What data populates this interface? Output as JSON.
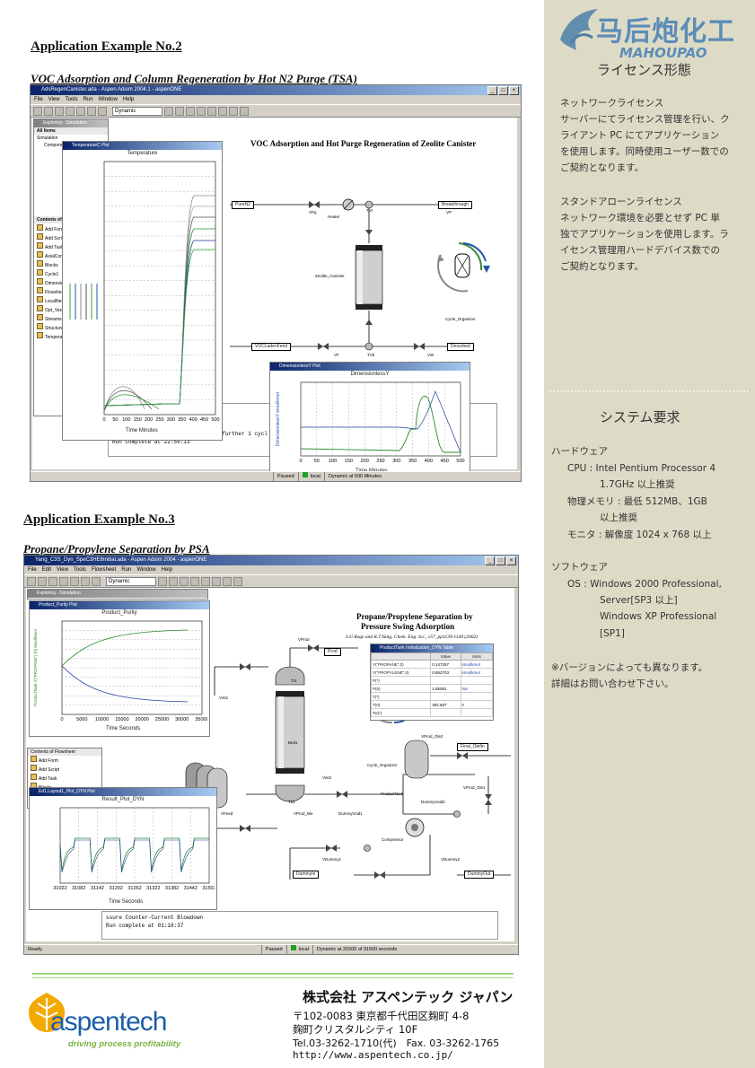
{
  "example2": {
    "heading": "Application Example No.2",
    "subheading": "VOC Adsorption and Column Regeneration by Hot N2 Purge (TSA)",
    "window_title": "AdsRegenCanister.ada - Aspen Adsim 2004.1 - aspenONE",
    "menu": [
      "File",
      "View",
      "Tools",
      "Run",
      "Window",
      "Help"
    ],
    "run_mode": "Dynamic",
    "explorer_title": "Exploring - Simulation",
    "explorer_header": "All Items",
    "explorer_items": [
      "Simulation",
      "Component Lists"
    ],
    "contents_header": "Contents of",
    "contents_items": [
      "Add Form",
      "Add Script",
      "Add Task",
      "AxialCom",
      "Blocks",
      "Cycle1",
      "Dimension",
      "Flowsheet",
      "Localfiles",
      "Opt_Vars",
      "Streams",
      "Structure",
      "Temperat"
    ],
    "flowsheet_title": "VOC Adsorption and Hot Purge Regeneration of Zeolite Canister",
    "tags": {
      "pure_n2": "PureN2",
      "breakthrough": "Breakthrough",
      "voc_feed": "VOCLadenFeed",
      "desorbed": "Desorbed"
    },
    "labels": {
      "vpg": "VPg",
      "heater": "Heater",
      "tvt": "TVt",
      "vp": "VP",
      "canister": "Zeolite_Canister",
      "cycle": "Cycle_Organizer",
      "vf": "VF",
      "tvb": "TVb",
      "vw": "VW"
    },
    "temp_plot": {
      "window": "TemperatureC Plot",
      "title": "Temperature",
      "xlabel": "Time Minutes",
      "xticks": [
        "0",
        "50",
        "100",
        "150",
        "200",
        "250",
        "300",
        "350",
        "400",
        "450",
        "500"
      ]
    },
    "dim_plot": {
      "window": "DimensionlessY Plot",
      "title": "DimensionlessY",
      "ylabel": "DimensionlessY kmol/kmol",
      "xlabel": "Time Minutes",
      "xticks": [
        "0",
        "50",
        "100",
        "150",
        "200",
        "250",
        "300",
        "350",
        "400",
        "450",
        "500"
      ]
    },
    "console": [
      "xp times...",
      "ecuted",
      "atically paused",
      "Press the run button to execute a further 1 cycl",
      "",
      "Run complete at 22:59:13"
    ],
    "status": {
      "state": "Paused",
      "mode": "local",
      "time": "Dynamic at 500 Minutes"
    }
  },
  "example3": {
    "heading": "Application Example No.3",
    "subheading": "Propane/Propylene Separation by PSA",
    "window_title": "Yang_C3S_Dyn_SpeC3HE6Initial.ada - Aspen Adsim 2004 - aspenONE",
    "menu": [
      "File",
      "Edit",
      "View",
      "Tools",
      "Flowsheet",
      "Run",
      "Window",
      "Help"
    ],
    "run_mode": "Dynamic",
    "explorer_title": "Exploring - Simulation",
    "flowsheet_title_1": "Propane/Propylene Separation by",
    "flowsheet_title_2": "Pressure Swing Adsorption",
    "flowsheet_ref": "S.U.Rege and R.T.Yang, Chem. Eng. Sci., v57, pp1139-1149 (2002)",
    "purity_plot": {
      "window": "Product_Purity Plot",
      "title": "Product_Purity",
      "ylabel": "ProductTank.Y(\"PROPANE\") (0) kmol/kmol",
      "xlabel": "Time Seconds",
      "xticks": [
        "0",
        "5000",
        "10000",
        "15000",
        "20000",
        "25000",
        "30000",
        "35000"
      ]
    },
    "result_plot": {
      "window": "Ed1.Layout1_Plot_DYN Plot",
      "title": "Result_Plot_DYN",
      "xlabel": "Time Seconds",
      "xticks": [
        "31022",
        "31082",
        "31142",
        "31202",
        "31262",
        "31322",
        "31382",
        "31442",
        "31502"
      ]
    },
    "table": {
      "window": "ProductTank Initialization_DYN Table",
      "headers": [
        "",
        "Value",
        "Units"
      ],
      "rows": [
        [
          "Y(\"PROPANE\",0)",
          "0.147297",
          "kmol/kmol"
        ],
        [
          "Y(\"PROPYLENE\",0)",
          "0.852703",
          "kmol/kmol"
        ],
        [
          "P(*)",
          "",
          ""
        ],
        [
          "P(0)",
          "1.85081",
          "bar"
        ],
        [
          "T(*)",
          "",
          ""
        ],
        [
          "T(0)",
          "382.687",
          "K"
        ],
        [
          "Tw(*)",
          "",
          ""
        ]
      ]
    },
    "contents_header": "Contents of Flowsheet",
    "contents_items": [
      "Add Form",
      "Add Script",
      "Add Task",
      "Blocks",
      "CS_Control_Table"
    ],
    "tags": {
      "prod": "Prod",
      "final_olefin": "Final_Olefin",
      "dummy_in": "DummyIn",
      "dummy_out": "DummyOut"
    },
    "labels": {
      "vprod": "VProd",
      "tr1": "Tr1",
      "vint1": "Vint1",
      "bed1": "Bed1",
      "cycle": "Cycle_Organizer",
      "intank": "Intank1",
      "tb1": "Tb1",
      "vint2": "Vint2",
      "vprod_ole2": "VProd_Ole2",
      "product_tank": "ProductTank",
      "vprod_ole1": "VProd_Ole1",
      "vfeed": "VFeed",
      "vprod_ble": "VProd_Ble",
      "dummy_void1": "DummyVoid1",
      "dummy_void2": "DummyVoid2",
      "compressor": "Compressor",
      "vdummy1": "VDummy1",
      "vdummy2": "VDummy2"
    },
    "console": [
      "ssure Counter-Current Blowdown",
      "Run complete at 01:18:37"
    ],
    "status": {
      "ready": "Ready",
      "state": "Paused",
      "mode": "local",
      "time": "Dynamic at 31500 of 31500 seconds"
    }
  },
  "sidebar": {
    "logo_text": "马后炮化工",
    "logo_sub": "MAHOUPAO",
    "license_title": "ライセンス形態",
    "network_title": "ネットワークライセンス",
    "network_body": [
      "サーバーにてライセンス管理を行い、ク",
      "ライアント PC にてアプリケーション",
      "を使用します。同時使用ユーザー数での",
      "ご契約となります。"
    ],
    "standalone_title": "スタンドアローンライセンス",
    "standalone_body": [
      "ネットワーク環境を必要とせず PC 単",
      "独でアプリケーションを使用します。ラ",
      "イセンス管理用ハードデバイス数での",
      "ご契約となります。"
    ],
    "sysreq_title": "システム要求",
    "hardware_title": "ハードウェア",
    "hardware_lines": [
      "CPU : Intel Pentium Processor 4",
      "1.7GHz 以上推奨",
      "物理メモリ : 最低 512MB、1GB",
      "以上推奨",
      "モニタ : 解像度 1024 x 768 以上"
    ],
    "software_title": "ソフトウェア",
    "software_lines": [
      "OS : Windows 2000 Professional,",
      "Server[SP3 以上]",
      "Windows XP Professional",
      "[SP1]"
    ],
    "note_lines": [
      "※バージョンによっても異なります。",
      "詳細はお問い合わせ下さい。"
    ]
  },
  "footer": {
    "logo_name": "aspentech",
    "tagline": "driving process profitability",
    "company": "株式会社 アスペンテック ジャパン",
    "address1": "〒102-0083 東京都千代田区麹町 4-8",
    "address2": "麹町クリスタルシティ 10F",
    "phone": "Tel.03-3262-1710(代)　Fax. 03-3262-1765",
    "url": "http://www.aspentech.co.jp/"
  },
  "colors": {
    "panel": "#dddbc6",
    "green_line": "#9ed67a",
    "aspen_orange": "#f2a900",
    "aspen_blue": "#1c5ea8",
    "title_blue": "#0a246a"
  }
}
